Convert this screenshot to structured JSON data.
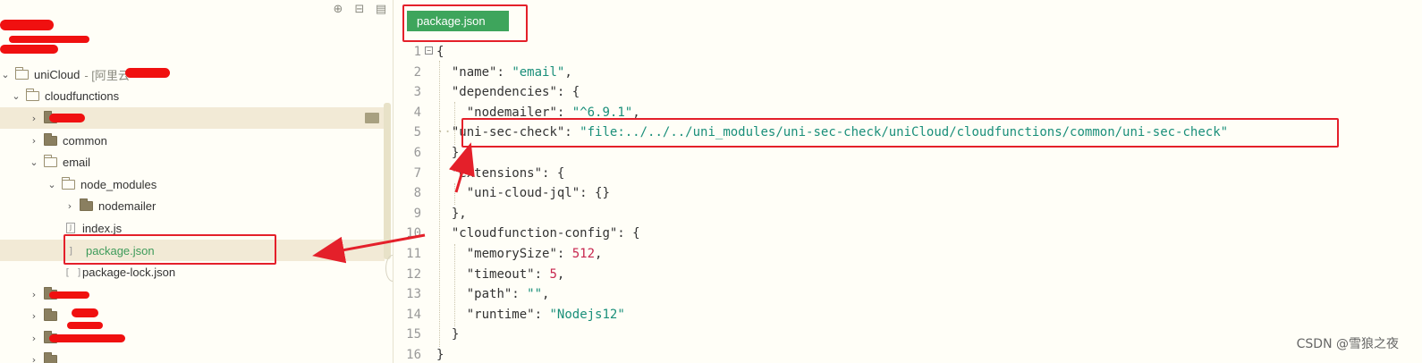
{
  "sidebar": {
    "toolbar": [
      {
        "icon": "target-icon",
        "glyph": "⊕"
      },
      {
        "icon": "collapse-icon",
        "glyph": "⊟"
      },
      {
        "icon": "panel-icon",
        "glyph": "▤"
      }
    ],
    "tree": {
      "unicloud": {
        "label": "uniCloud",
        "suffix": "- [阿里云"
      },
      "cloudfunctions": {
        "label": "cloudfunctions"
      },
      "common": {
        "label": "common"
      },
      "email": {
        "label": "email"
      },
      "node_modules": {
        "label": "node_modules"
      },
      "nodemailer": {
        "label": "nodemailer"
      },
      "index_js": {
        "label": "index.js"
      },
      "package_json": {
        "label": "package.json"
      },
      "package_lock": {
        "label": "package-lock.json"
      }
    }
  },
  "editor": {
    "tab_label": "package.json",
    "lines": [
      {
        "n": "1",
        "code": "{"
      },
      {
        "n": "2",
        "key": "name",
        "value": "email",
        "tail": ","
      },
      {
        "n": "3",
        "key": "dependencies",
        "open": "{"
      },
      {
        "n": "4",
        "key": "nodemailer",
        "value": "^6.9.1",
        "tail": ","
      },
      {
        "n": "5",
        "key": "uni-sec-check",
        "value": "file:../../../uni_modules/uni-sec-check/uniCloud/cloudfunctions/common/uni-sec-check"
      },
      {
        "n": "6",
        "code": "},"
      },
      {
        "n": "7",
        "key": "extensions",
        "open": "{"
      },
      {
        "n": "8",
        "key": "uni-cloud-jql",
        "open": "{}"
      },
      {
        "n": "9",
        "code": "},"
      },
      {
        "n": "10",
        "key": "cloudfunction-config",
        "open": "{"
      },
      {
        "n": "11",
        "key": "memorySize",
        "number": "512",
        "tail": ","
      },
      {
        "n": "12",
        "key": "timeout",
        "number": "5",
        "tail": ","
      },
      {
        "n": "13",
        "key": "path",
        "value": "",
        "tail": ","
      },
      {
        "n": "14",
        "key": "runtime",
        "value": "Nodejs12"
      },
      {
        "n": "15",
        "code": "}"
      },
      {
        "n": "16",
        "code": "}"
      }
    ]
  },
  "watermark": "CSDN @雪狼之夜",
  "colors": {
    "accent_green": "#3ea55c",
    "annotation_red": "#e4202a",
    "string": "#1a8f7a",
    "number": "#c7254e"
  }
}
